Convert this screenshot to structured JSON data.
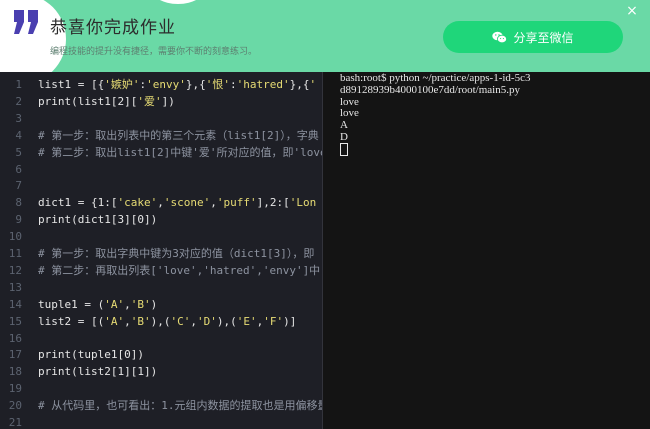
{
  "banner": {
    "title": "恭喜你完成作业",
    "subtitle": "编程技能的提升没有捷径，需要你不断的刻意练习。",
    "share_label": "分享至微信",
    "close_label": "×",
    "accent_color": "#6ad9a6",
    "button_color": "#1fd67a"
  },
  "editor": {
    "lines": [
      {
        "n": "1",
        "tokens": [
          [
            "p",
            "list1 = [{"
          ],
          [
            "s",
            "'嫉妒'"
          ],
          [
            "p",
            ":"
          ],
          [
            "s",
            "'envy'"
          ],
          [
            "p",
            "},{"
          ],
          [
            "s",
            "'恨'"
          ],
          [
            "p",
            ":"
          ],
          [
            "s",
            "'hatred'"
          ],
          [
            "p",
            "},{"
          ],
          [
            "s",
            "'"
          ]
        ]
      },
      {
        "n": "2",
        "tokens": [
          [
            "p",
            "print(list1["
          ],
          [
            "n",
            "2"
          ],
          [
            "p",
            "]["
          ],
          [
            "s",
            "'爱'"
          ],
          [
            "p",
            "])"
          ]
        ]
      },
      {
        "n": "3",
        "tokens": []
      },
      {
        "n": "4",
        "tokens": [
          [
            "c",
            "# 第一步：取出列表中的第三个元素（list1[2]），字典"
          ]
        ]
      },
      {
        "n": "5",
        "tokens": [
          [
            "c",
            "# 第二步：取出list1[2]中键'爱'所对应的值，即'love"
          ]
        ]
      },
      {
        "n": "6",
        "tokens": []
      },
      {
        "n": "7",
        "tokens": []
      },
      {
        "n": "8",
        "tokens": [
          [
            "p",
            "dict1 = {"
          ],
          [
            "n",
            "1"
          ],
          [
            "p",
            ":["
          ],
          [
            "s",
            "'cake'"
          ],
          [
            "p",
            ","
          ],
          [
            "s",
            "'scone'"
          ],
          [
            "p",
            ","
          ],
          [
            "s",
            "'puff'"
          ],
          [
            "p",
            "],"
          ],
          [
            "n",
            "2"
          ],
          [
            "p",
            ":["
          ],
          [
            "s",
            "'Lon"
          ]
        ]
      },
      {
        "n": "9",
        "tokens": [
          [
            "p",
            "print(dict1["
          ],
          [
            "n",
            "3"
          ],
          [
            "p",
            "]["
          ],
          [
            "n",
            "0"
          ],
          [
            "p",
            "])"
          ]
        ]
      },
      {
        "n": "10",
        "tokens": []
      },
      {
        "n": "11",
        "tokens": [
          [
            "c",
            "# 第一步：取出字典中键为3对应的值（dict1[3]），即"
          ]
        ]
      },
      {
        "n": "12",
        "tokens": [
          [
            "c",
            "# 第二步：再取出列表['love','hatred','envy']中"
          ]
        ]
      },
      {
        "n": "13",
        "tokens": []
      },
      {
        "n": "14",
        "tokens": [
          [
            "p",
            "tuple1 = ("
          ],
          [
            "s",
            "'A'"
          ],
          [
            "p",
            ","
          ],
          [
            "s",
            "'B'"
          ],
          [
            "p",
            ")"
          ]
        ]
      },
      {
        "n": "15",
        "tokens": [
          [
            "p",
            "list2 = [("
          ],
          [
            "s",
            "'A'"
          ],
          [
            "p",
            ","
          ],
          [
            "s",
            "'B'"
          ],
          [
            "p",
            "),("
          ],
          [
            "s",
            "'C'"
          ],
          [
            "p",
            ","
          ],
          [
            "s",
            "'D'"
          ],
          [
            "p",
            "),("
          ],
          [
            "s",
            "'E'"
          ],
          [
            "p",
            ","
          ],
          [
            "s",
            "'F'"
          ],
          [
            "p",
            ")]"
          ]
        ]
      },
      {
        "n": "16",
        "tokens": []
      },
      {
        "n": "17",
        "tokens": [
          [
            "p",
            "print(tuple1["
          ],
          [
            "n",
            "0"
          ],
          [
            "p",
            "])"
          ]
        ]
      },
      {
        "n": "18",
        "tokens": [
          [
            "p",
            "print(list2["
          ],
          [
            "n",
            "1"
          ],
          [
            "p",
            "]["
          ],
          [
            "n",
            "1"
          ],
          [
            "p",
            "])"
          ]
        ]
      },
      {
        "n": "19",
        "tokens": []
      },
      {
        "n": "20",
        "tokens": [
          [
            "c",
            "# 从代码里，也可看出：1.元组内数据的提取也是用偏移量"
          ]
        ]
      },
      {
        "n": "21",
        "tokens": []
      }
    ]
  },
  "terminal": {
    "lines": [
      "bash:root$ python ~/practice/apps-1-id-5c3",
      "d89128939b4000100e7dd/root/main5.py",
      "love",
      "love",
      "A",
      "D"
    ]
  }
}
